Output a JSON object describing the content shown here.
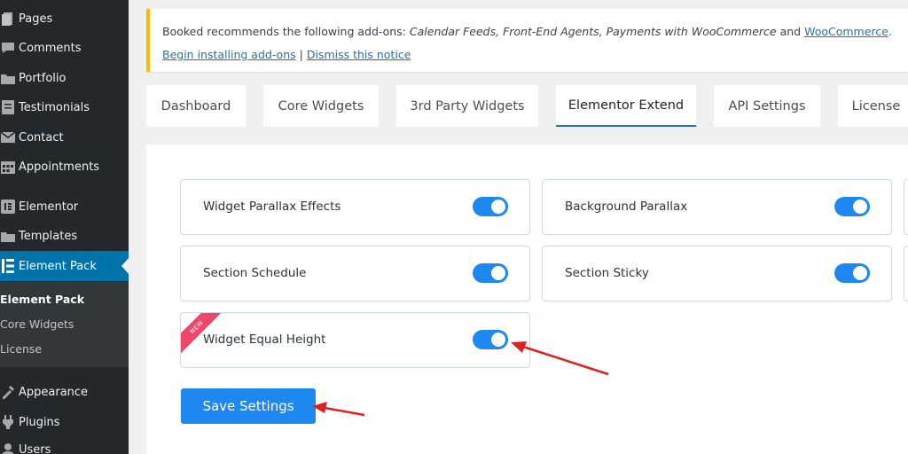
{
  "sidebar": {
    "items": [
      {
        "icon": "pages-icon",
        "label": "Pages"
      },
      {
        "icon": "comments-icon",
        "label": "Comments"
      },
      {
        "icon": "portfolio-icon",
        "label": "Portfolio"
      },
      {
        "icon": "testimonials-icon",
        "label": "Testimonials"
      },
      {
        "icon": "contact-icon",
        "label": "Contact"
      },
      {
        "icon": "calendar-icon",
        "label": "Appointments"
      },
      {
        "icon": "elementor-icon",
        "label": "Elementor"
      },
      {
        "icon": "templates-icon",
        "label": "Templates"
      },
      {
        "icon": "element-pack-icon",
        "label": "Element Pack"
      },
      {
        "icon": "appearance-icon",
        "label": "Appearance"
      },
      {
        "icon": "plugins-icon",
        "label": "Plugins"
      },
      {
        "icon": "users-icon",
        "label": "Users"
      }
    ],
    "submenu": [
      "Element Pack",
      "Core Widgets",
      "License"
    ]
  },
  "notice": {
    "prefix": "Booked recommends the following add-ons: ",
    "addons": "Calendar Feeds, Front-End Agents, Payments with WooCommerce",
    "and": " and ",
    "woo_link": "WooCommerce",
    "end": ".",
    "install_link": "Begin installing add-ons",
    "separator": " | ",
    "dismiss_link": "Dismiss this notice"
  },
  "tabs": [
    "Dashboard",
    "Core Widgets",
    "3rd Party Widgets",
    "Elementor Extend",
    "API Settings",
    "License"
  ],
  "settings": [
    {
      "label": "Widget Parallax Effects",
      "enabled": true
    },
    {
      "label": "Background Parallax",
      "enabled": true
    },
    {
      "label": "Section Schedule",
      "enabled": true
    },
    {
      "label": "Section Sticky",
      "enabled": true
    },
    {
      "label": "Widget Equal Height",
      "enabled": true,
      "badge": "NEW"
    }
  ],
  "save_button": "Save Settings",
  "colors": {
    "accent": "#1e87f0",
    "sidebar_bg": "#23282d",
    "active_menu": "#0073aa",
    "notice_border": "#ffb900",
    "badge": "#f0466a",
    "arrow": "#e02020"
  }
}
